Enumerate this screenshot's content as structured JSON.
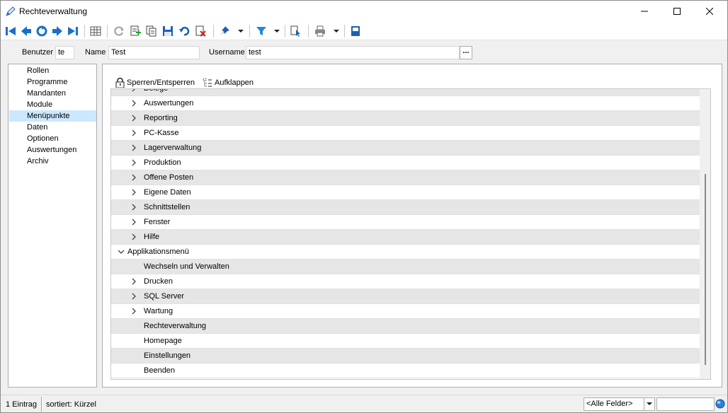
{
  "window": {
    "title": "Rechteverwaltung"
  },
  "toolbar": {
    "icons": [
      "first-icon",
      "prev-icon",
      "refresh-circle-icon",
      "next-icon",
      "last-icon",
      "table-icon",
      "reload-icon",
      "new-record-icon",
      "copy-icon",
      "save-icon",
      "undo-icon",
      "delete-icon",
      "pin-icon",
      "filter-icon",
      "cursor-icon",
      "print-icon",
      "book-icon"
    ]
  },
  "header": {
    "benutzer_label": "Benutzer",
    "benutzer_value": "te",
    "name_label": "Name",
    "name_value": "Test",
    "username_label": "Username",
    "username_value": "test",
    "ellipsis": "..."
  },
  "sidebar": {
    "items": [
      {
        "label": "Rollen",
        "selected": false
      },
      {
        "label": "Programme",
        "selected": false
      },
      {
        "label": "Mandanten",
        "selected": false
      },
      {
        "label": "Module",
        "selected": false
      },
      {
        "label": "Menüpunkte",
        "selected": true
      },
      {
        "label": "Daten",
        "selected": false
      },
      {
        "label": "Optionen",
        "selected": false
      },
      {
        "label": "Auswertungen",
        "selected": false
      },
      {
        "label": "Archiv",
        "selected": false
      }
    ]
  },
  "main": {
    "lock_button": "Sperren/Entsperren",
    "expand_button": "Aufklappen",
    "tree": [
      {
        "label": "Belege",
        "level": 1,
        "state": "collapsed"
      },
      {
        "label": "Auswertungen",
        "level": 1,
        "state": "collapsed"
      },
      {
        "label": "Reporting",
        "level": 1,
        "state": "collapsed"
      },
      {
        "label": "PC-Kasse",
        "level": 1,
        "state": "collapsed"
      },
      {
        "label": "Lagerverwaltung",
        "level": 1,
        "state": "collapsed"
      },
      {
        "label": "Produktion",
        "level": 1,
        "state": "collapsed"
      },
      {
        "label": "Offene Posten",
        "level": 1,
        "state": "collapsed"
      },
      {
        "label": "Eigene Daten",
        "level": 1,
        "state": "collapsed"
      },
      {
        "label": "Schnittstellen",
        "level": 1,
        "state": "collapsed"
      },
      {
        "label": "Fenster",
        "level": 1,
        "state": "collapsed"
      },
      {
        "label": "Hilfe",
        "level": 1,
        "state": "collapsed"
      },
      {
        "label": "Applikationsmenü",
        "level": 0,
        "state": "expanded"
      },
      {
        "label": "Wechseln und Verwalten",
        "level": 1,
        "state": "leaf"
      },
      {
        "label": "Drucken",
        "level": 1,
        "state": "collapsed"
      },
      {
        "label": "SQL Server",
        "level": 1,
        "state": "collapsed"
      },
      {
        "label": "Wartung",
        "level": 1,
        "state": "collapsed"
      },
      {
        "label": "Rechteverwaltung",
        "level": 1,
        "state": "leaf"
      },
      {
        "label": "Homepage",
        "level": 1,
        "state": "leaf"
      },
      {
        "label": "Einstellungen",
        "level": 1,
        "state": "leaf"
      },
      {
        "label": "Beenden",
        "level": 1,
        "state": "leaf"
      }
    ]
  },
  "statusbar": {
    "count": "1 Eintrag",
    "sort": "sortiert: Kürzel",
    "field_select": "<Alle Felder>"
  }
}
